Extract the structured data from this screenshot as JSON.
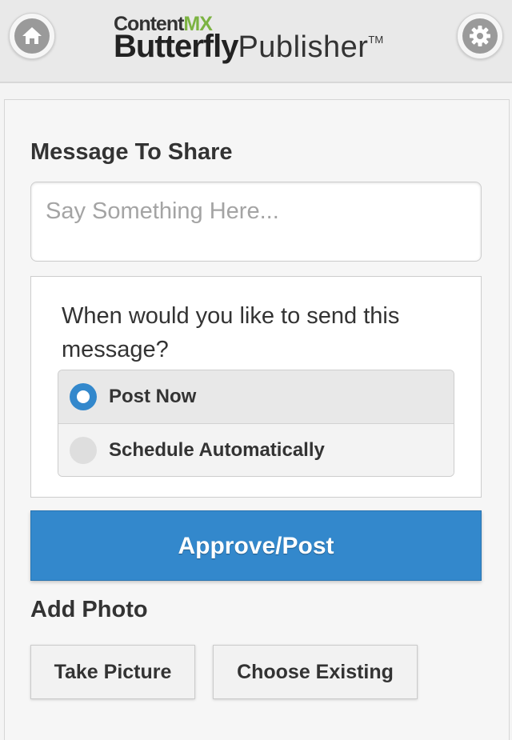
{
  "header": {
    "logo_top_main": "Content",
    "logo_top_accent": "MX",
    "logo_bottom_bold": "Butterfly",
    "logo_bottom_regular": "Publisher",
    "logo_trademark": "TM",
    "home_icon": "home-icon",
    "settings_icon": "gear-icon"
  },
  "message": {
    "title": "Message To Share",
    "placeholder": "Say Something Here..."
  },
  "schedule": {
    "question": "When would you like to send this message?",
    "options": [
      {
        "label": "Post Now",
        "selected": true
      },
      {
        "label": "Schedule Automatically",
        "selected": false
      }
    ]
  },
  "actions": {
    "approve_label": "Approve/Post"
  },
  "photo": {
    "title": "Add Photo",
    "take_label": "Take Picture",
    "choose_label": "Choose Existing"
  },
  "colors": {
    "accent": "#3388cc",
    "logo_accent": "#7cb342"
  }
}
